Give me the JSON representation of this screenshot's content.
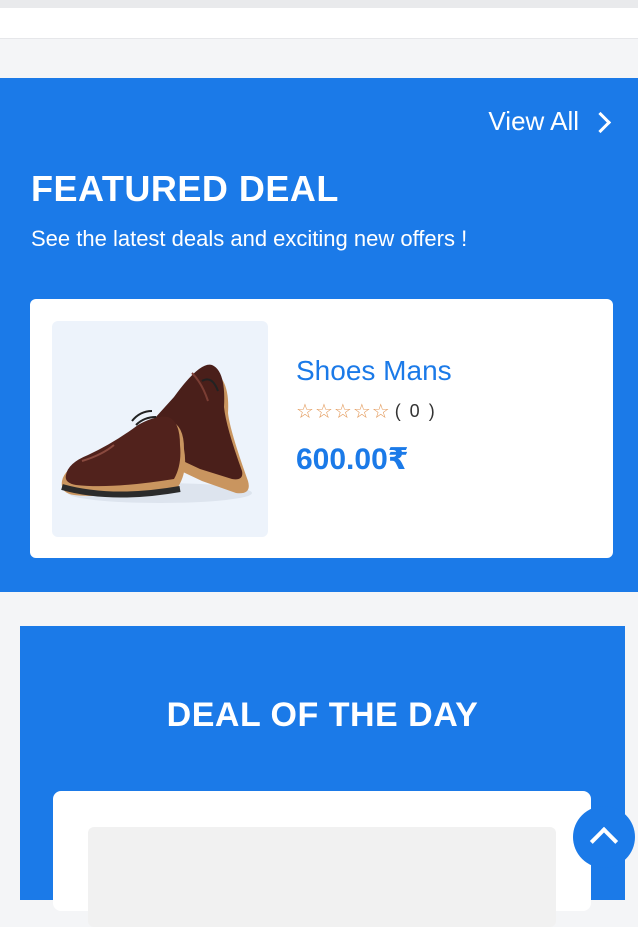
{
  "featured_deal": {
    "view_all_label": "View All",
    "title": "FEATURED DEAL",
    "subtitle": "See the latest deals and exciting new offers !",
    "product": {
      "name": "Shoes Mans",
      "rating": 0,
      "review_count": "( 0 )",
      "price": "600.00₹"
    }
  },
  "deal_of_the_day": {
    "title": "DEAL OF THE DAY"
  },
  "colors": {
    "primary_blue": "#1b7ae8",
    "star_outline": "#e39a5b"
  }
}
